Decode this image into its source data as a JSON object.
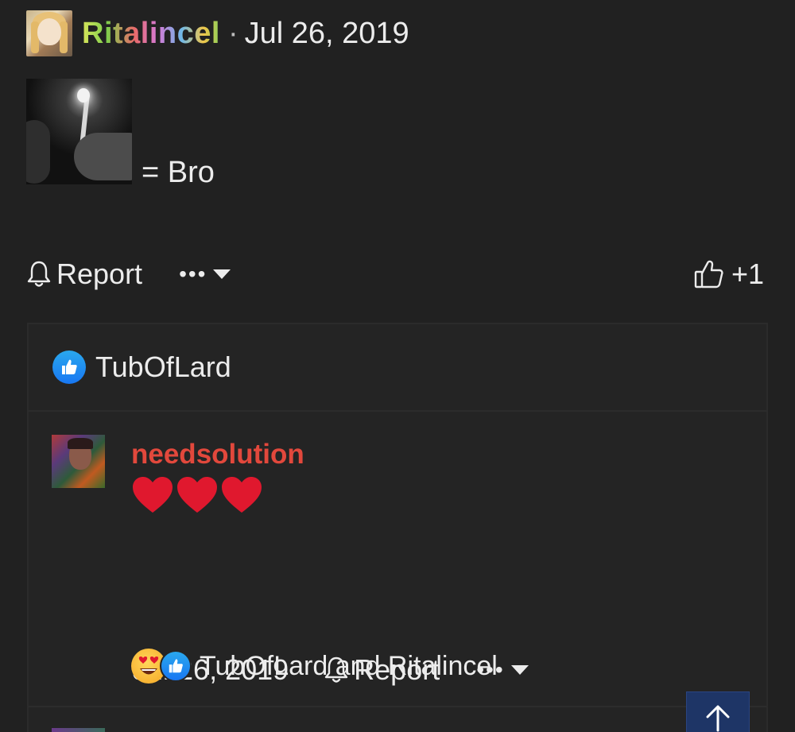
{
  "post": {
    "author": "Ritalincel",
    "separator": "·",
    "date": "Jul 26, 2019",
    "text": "= Bro",
    "actions": {
      "report_label": "Report",
      "more_label": "•••",
      "like_count": "+1"
    }
  },
  "reactions": {
    "users": "TubOfLard"
  },
  "comment": {
    "author": "needsolution",
    "author_color": "#e2483c",
    "hearts_count": 3,
    "date": "Jul 26, 2019",
    "report_label": "Report",
    "more_label": "•••",
    "reaction_summary": "TubOfLard and Ritalincel"
  },
  "colors": {
    "background": "#212121",
    "text": "#ececec",
    "like_blue": "#1877f2",
    "heart_red": "#e0182e",
    "scroll_button": "#1e3566"
  },
  "icons": [
    "bell-icon",
    "thumbs-up-outline-icon",
    "like-reaction-icon",
    "heart-eyes-emoji-icon",
    "heart-icon",
    "arrow-up-icon",
    "caret-down-icon"
  ]
}
